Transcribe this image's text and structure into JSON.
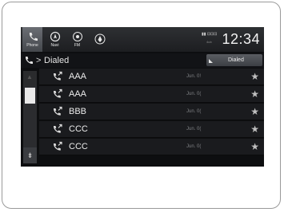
{
  "apps": [
    {
      "label": "Phone",
      "icon": "phone-icon",
      "active": true
    },
    {
      "label": "Navi",
      "icon": "navi-icon",
      "active": false
    },
    {
      "label": "FM",
      "icon": "radio-icon",
      "active": false
    },
    {
      "label": "",
      "icon": "app-icon",
      "active": false
    }
  ],
  "status": {
    "sig": "▮▮ ⊡⊡⊡",
    "sub": "4ub"
  },
  "clock": "12:34",
  "header": {
    "chevron": ">",
    "title": "Dialed",
    "sort_label": "Dialed"
  },
  "scroll": {
    "down_glyph": "⇟"
  },
  "calls": [
    {
      "name": "AAA",
      "date": "Jun. 0!",
      "star": "★"
    },
    {
      "name": "AAA",
      "date": "Jun. 0(",
      "star": "★"
    },
    {
      "name": "BBB",
      "date": "Jun. 0(",
      "star": "★"
    },
    {
      "name": "CCC",
      "date": "Jun. 0(",
      "star": "★"
    },
    {
      "name": "CCC",
      "date": "Jun. 0(",
      "star": "★"
    }
  ],
  "colors": {
    "screen_bg": "#0d0e10",
    "row_bg": "#1a1b1e",
    "accent": "#e9e9e9"
  }
}
